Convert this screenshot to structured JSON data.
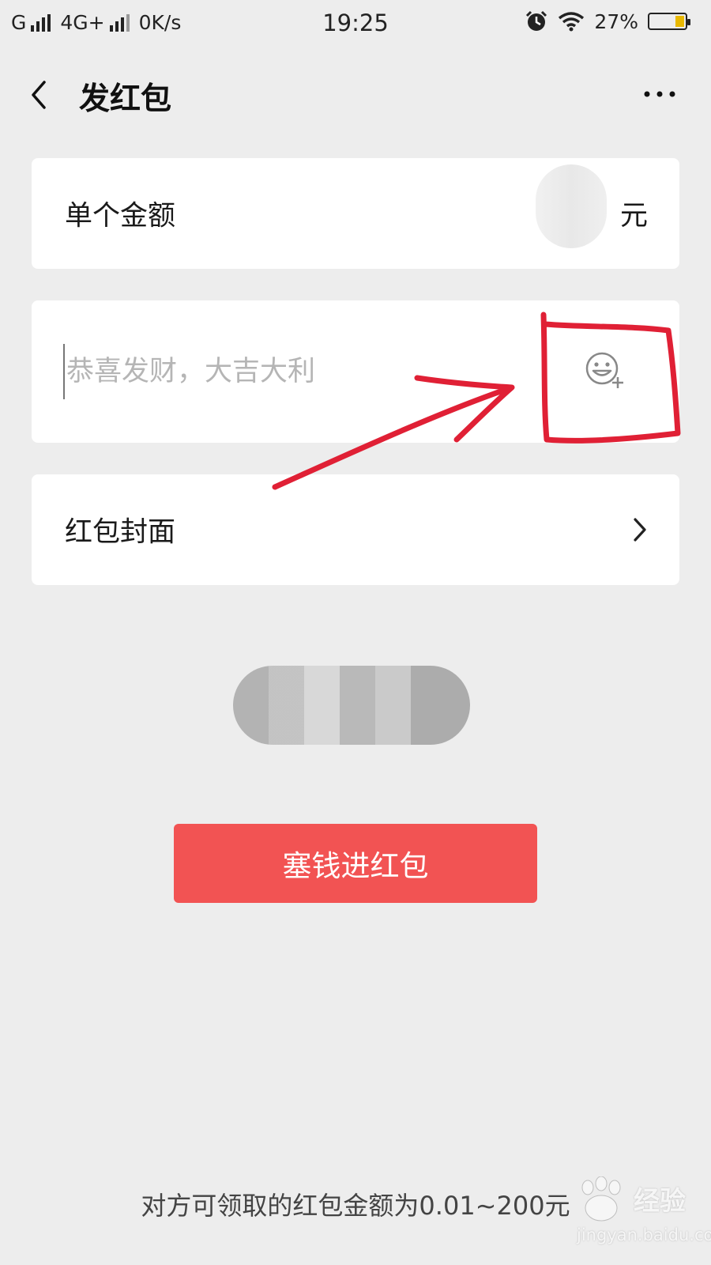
{
  "status_bar": {
    "carrier_1": "G",
    "carrier_2": "4G+",
    "net_speed": "0K/s",
    "time": "19:25",
    "battery": "27%",
    "battery_level": 0.27,
    "icons": [
      "signal-icon",
      "alarm-clock-icon",
      "wifi-icon",
      "battery-icon"
    ]
  },
  "nav": {
    "title": "发红包",
    "back_icon": "chevron-left-icon",
    "more_icon": "more-dots-icon"
  },
  "amount_card": {
    "label": "单个金额",
    "unit": "元"
  },
  "message_card": {
    "placeholder": "恭喜发财，大吉大利",
    "value": "",
    "emoji_icon": "emoji-add-icon"
  },
  "cover_card": {
    "label": "红包封面",
    "chevron_icon": "chevron-right-icon"
  },
  "send_button": {
    "label": "塞钱进红包",
    "color": "#f25353"
  },
  "footer": {
    "note": "对方可领取的红包金额为0.01~200元"
  },
  "watermark": {
    "word": "经验",
    "url": "jingyan.baidu.com",
    "logo_icon": "baidu-paw-icon"
  },
  "colors": {
    "background": "#ededed",
    "card": "#ffffff",
    "annotation_red": "#e02035"
  }
}
